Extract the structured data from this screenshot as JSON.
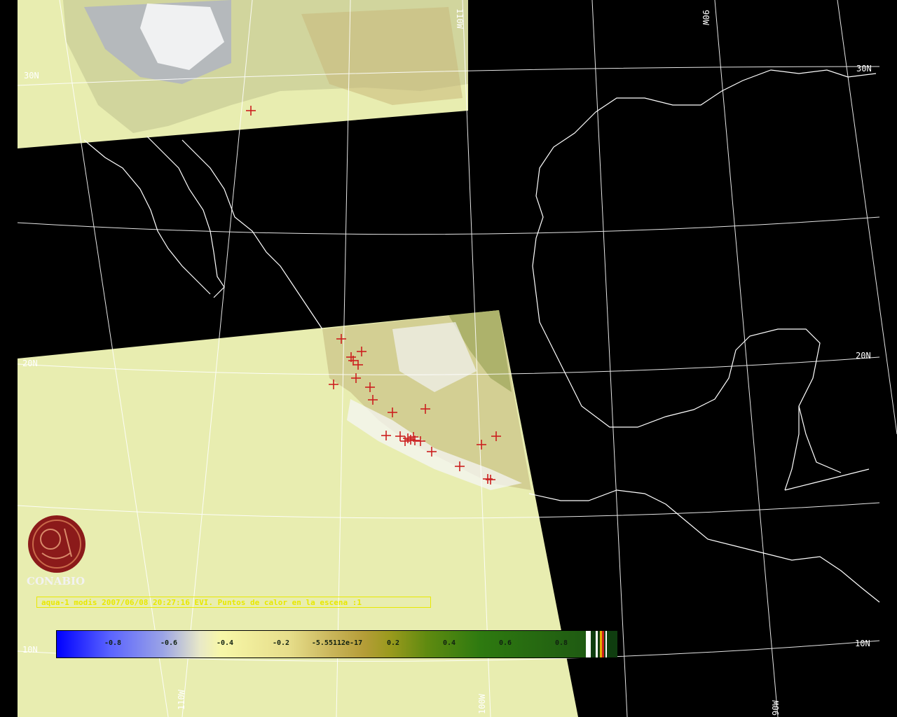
{
  "map": {
    "caption": "aqua-1 modis 2007/06/08 20:27:16 EVI. Puntos de calor en la escena :1",
    "logo_text": "CONABIO",
    "grid_labels": {
      "lat_30": "30N",
      "lat_30_right": "30N",
      "lat_20": "20N",
      "lat_20_right": "20N",
      "lat_10": "10N",
      "lat_10_right": "10N",
      "lon_110_top": "110W",
      "lon_90_top": "90W",
      "lon_110_bottom": "110W",
      "lon_100_bottom": "100W",
      "lon_90_bottom": "90W"
    },
    "colors": {
      "ocean_fill": "#e8edb0",
      "land_background": "#000000",
      "coastline": "#ffffff",
      "fire_marker": "#cc1f1f",
      "caption_yellow": "#e8e800",
      "logo_red": "#8b1a1a"
    },
    "fire_points_visible": 26
  },
  "colorbar": {
    "ticks": [
      "-0.8",
      "-0.6",
      "-0.4",
      "-0.2",
      "-5.55112e-17",
      "0.2",
      "0.4",
      "0.6",
      "0.8"
    ]
  }
}
